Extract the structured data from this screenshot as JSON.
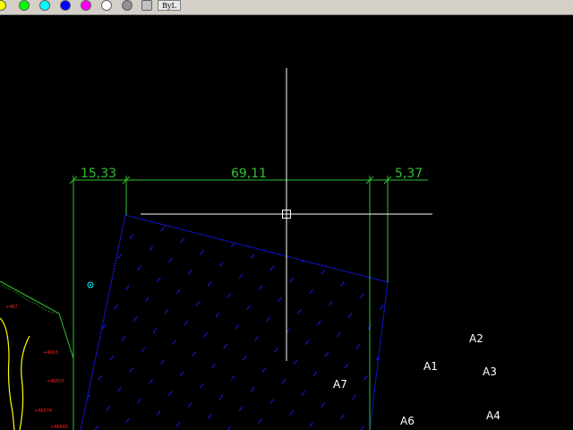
{
  "toolbar": {
    "colors": [
      {
        "name": "yellow",
        "hex": "#ffff00"
      },
      {
        "name": "green",
        "hex": "#00ff00"
      },
      {
        "name": "cyan",
        "hex": "#00ffff"
      },
      {
        "name": "blue",
        "hex": "#0000ff"
      },
      {
        "name": "magenta",
        "hex": "#ff00ff"
      },
      {
        "name": "white",
        "hex": "#ffffff"
      },
      {
        "name": "gray",
        "hex": "#909090"
      },
      {
        "name": "light-gray",
        "hex": "#c0c0c0"
      }
    ],
    "bylayer_label": "ByL"
  },
  "drawing": {
    "dimensions": [
      "15,33",
      "69,11",
      "5,37"
    ],
    "point_labels": [
      "A2",
      "A1",
      "A3",
      "A7",
      "A6",
      "A4"
    ],
    "elevations": [
      "+467",
      "+4663",
      "+46507",
      "+46574",
      "+46645"
    ],
    "colors": {
      "dimension": "#30c030",
      "hatch": "#1818ff",
      "crosshair": "#ffffff",
      "contour": "#ffff00",
      "elevation": "#ff2020"
    }
  }
}
